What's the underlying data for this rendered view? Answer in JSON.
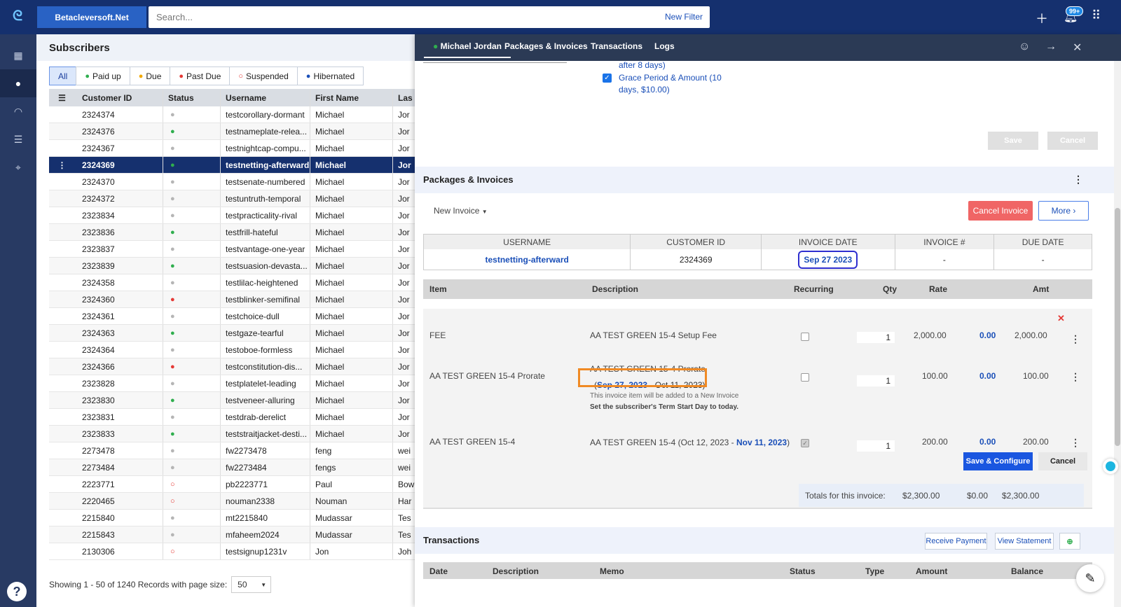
{
  "topbar": {
    "account": "Betacleversoft.Net",
    "search_placeholder": "Search...",
    "new_filter": "New Filter",
    "notif_badge": "99+"
  },
  "subscribers": {
    "title": "Subscribers",
    "filters": [
      "All",
      "Paid up",
      "Due",
      "Past Due",
      "Suspended",
      "Hibernated"
    ],
    "columns": [
      "Customer ID",
      "Status",
      "Username",
      "First Name",
      "Las"
    ],
    "rows": [
      {
        "id": "2324374",
        "status": "grey",
        "user": "testcorollary-dormant",
        "first": "Michael",
        "last": "Jor"
      },
      {
        "id": "2324376",
        "status": "green",
        "user": "testnameplate-relea...",
        "first": "Michael",
        "last": "Jor"
      },
      {
        "id": "2324367",
        "status": "grey",
        "user": "testnightcap-compu...",
        "first": "Michael",
        "last": "Jor"
      },
      {
        "id": "2324369",
        "status": "green",
        "user": "testnetting-afterward",
        "first": "Michael",
        "last": "Jor"
      },
      {
        "id": "2324370",
        "status": "grey",
        "user": "testsenate-numbered",
        "first": "Michael",
        "last": "Jor"
      },
      {
        "id": "2324372",
        "status": "grey",
        "user": "testuntruth-temporal",
        "first": "Michael",
        "last": "Jor"
      },
      {
        "id": "2323834",
        "status": "grey",
        "user": "testpracticality-rival",
        "first": "Michael",
        "last": "Jor"
      },
      {
        "id": "2323836",
        "status": "green",
        "user": "testfrill-hateful",
        "first": "Michael",
        "last": "Jor"
      },
      {
        "id": "2323837",
        "status": "grey",
        "user": "testvantage-one-year",
        "first": "Michael",
        "last": "Jor"
      },
      {
        "id": "2323839",
        "status": "green",
        "user": "testsuasion-devasta...",
        "first": "Michael",
        "last": "Jor"
      },
      {
        "id": "2324358",
        "status": "grey",
        "user": "testlilac-heightened",
        "first": "Michael",
        "last": "Jor"
      },
      {
        "id": "2324360",
        "status": "red",
        "user": "testblinker-semifinal",
        "first": "Michael",
        "last": "Jor"
      },
      {
        "id": "2324361",
        "status": "grey",
        "user": "testchoice-dull",
        "first": "Michael",
        "last": "Jor"
      },
      {
        "id": "2324363",
        "status": "green",
        "user": "testgaze-tearful",
        "first": "Michael",
        "last": "Jor"
      },
      {
        "id": "2324364",
        "status": "grey",
        "user": "testoboe-formless",
        "first": "Michael",
        "last": "Jor"
      },
      {
        "id": "2324366",
        "status": "red",
        "user": "testconstitution-dis...",
        "first": "Michael",
        "last": "Jor"
      },
      {
        "id": "2323828",
        "status": "grey",
        "user": "testplatelet-leading",
        "first": "Michael",
        "last": "Jor"
      },
      {
        "id": "2323830",
        "status": "green",
        "user": "testveneer-alluring",
        "first": "Michael",
        "last": "Jor"
      },
      {
        "id": "2323831",
        "status": "grey",
        "user": "testdrab-derelict",
        "first": "Michael",
        "last": "Jor"
      },
      {
        "id": "2323833",
        "status": "green",
        "user": "teststraitjacket-desti...",
        "first": "Michael",
        "last": "Jor"
      },
      {
        "id": "2273478",
        "status": "grey",
        "user": "fw2273478",
        "first": "feng",
        "last": "wei"
      },
      {
        "id": "2273484",
        "status": "grey",
        "user": "fw2273484",
        "first": "fengs",
        "last": "wei"
      },
      {
        "id": "2223771",
        "status": "red-outline",
        "user": "pb2223771",
        "first": "Paul",
        "last": "Bow"
      },
      {
        "id": "2220465",
        "status": "red-outline",
        "user": "nouman2338",
        "first": "Nouman",
        "last": "Har"
      },
      {
        "id": "2215840",
        "status": "grey",
        "user": "mt2215840",
        "first": "Mudassar",
        "last": "Tes"
      },
      {
        "id": "2215843",
        "status": "grey",
        "user": "mfaheem2024",
        "first": "Mudassar",
        "last": "Tes"
      },
      {
        "id": "2130306",
        "status": "red-outline",
        "user": "testsignup1231v",
        "first": "Jon",
        "last": "Joh"
      }
    ],
    "selected_index": 3,
    "paging_text": "Showing 1 - 50 of 1240 Records with page size:",
    "page_size": "50"
  },
  "drawer": {
    "tabs": [
      "Michael Jordan",
      "Packages & Invoices",
      "Transactions",
      "Logs"
    ],
    "check1": "after 8 days)",
    "check2_line1": "Grace Period & Amount (10",
    "check2_line2": "days, $10.00)",
    "save": "Save",
    "cancel": "Cancel",
    "pkg_title": "Packages & Invoices",
    "new_invoice": "New Invoice",
    "cancel_invoice": "Cancel Invoice",
    "more": "More",
    "inv_headers": [
      "USERNAME",
      "CUSTOMER ID",
      "INVOICE DATE",
      "INVOICE #",
      "DUE DATE"
    ],
    "inv_values": [
      "testnetting-afterward",
      "2324369",
      "Sep 27 2023",
      "-",
      "-"
    ],
    "item_headers": [
      "Item",
      "Description",
      "Recurring",
      "Qty",
      "Rate",
      "Amt"
    ],
    "items": [
      {
        "item": "FEE",
        "desc": "AA TEST GREEN 15-4 Setup Fee",
        "qty": "1",
        "rate": "2,000.00",
        "disc": "0.00",
        "amt": "2,000.00"
      },
      {
        "item": "AA TEST GREEN 15-4 Prorate",
        "desc": "AA TEST GREEN 15-4 Prorate",
        "qty": "1",
        "rate": "100.00",
        "disc": "0.00",
        "amt": "100.00"
      },
      {
        "item": "AA TEST GREEN 15-4",
        "desc": "AA TEST GREEN 15-4 (Oct 12, 2023 -",
        "qty": "1",
        "rate": "200.00",
        "disc": "0.00",
        "amt": "200.00"
      }
    ],
    "prorate_open": "(",
    "prorate_start": "Sep 27, 2023",
    "prorate_end": " - Oct 11, 2023)",
    "prorate_note": "This invoice item will be added to a New Invoice",
    "prorate_link": "Set the subscriber's Term Start Day to today.",
    "item3_end": "Nov 11, 2023",
    "item3_close": ")",
    "save_configure": "Save & Configure",
    "cancel2": "Cancel",
    "totals_label": "Totals for this invoice:",
    "totals": [
      "$2,300.00",
      "$0.00",
      "$2,300.00"
    ],
    "trans_title": "Transactions",
    "receive_payment": "Receive Payment",
    "view_statement": "View Statement",
    "trans_headers": [
      "Date",
      "Description",
      "Memo",
      "Status",
      "Type",
      "Amount",
      "Balance"
    ]
  },
  "colors": {
    "topbar": "#15306e",
    "green": "#2fae4e",
    "red": "#e53935",
    "grey": "#b5b5b5",
    "accent": "#1a4fb8"
  }
}
